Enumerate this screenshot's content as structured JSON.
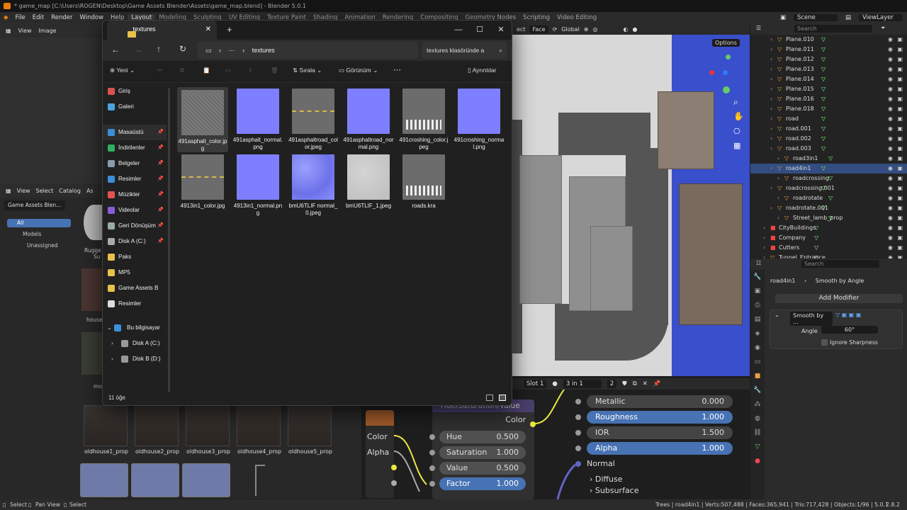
{
  "window": {
    "title": "* game_map [C:\\Users\\ROGEN\\Desktop\\Game Assets Blender\\Assets\\game_map.blend] - Blender 5.0.1"
  },
  "menu": [
    "File",
    "Edit",
    "Render",
    "Window",
    "Help"
  ],
  "workspace_tabs": [
    "Layout",
    "Modeling",
    "Sculpting",
    "UV Editing",
    "Texture Paint",
    "Shading",
    "Animation",
    "Rendering",
    "Compositing",
    "Geometry Nodes",
    "Scripting",
    "Video Editing"
  ],
  "scene": {
    "scene_label": "Scene",
    "viewlayer_label": "ViewLayer"
  },
  "image_editor": {
    "view": "View",
    "image": "Image"
  },
  "asset_browser": {
    "menus": [
      "View",
      "Select",
      "Catalog",
      "As"
    ],
    "library": "Game Assets Blen...",
    "all": "All",
    "models": "Models",
    "unassigned": "Unassigned",
    "props": [
      "oldhouse1_prop",
      "oldhouse2_prop",
      "oldhouse3_prop",
      "oldhouse4_prop",
      "oldhouse5_prop"
    ],
    "side_labels": [
      "Rugge",
      "Su",
      "house",
      "mo"
    ]
  },
  "viewport": {
    "mode": "Face",
    "orientation": "Global",
    "options": "Options",
    "select_label": "ect"
  },
  "outliner": {
    "search_placeholder": "Search",
    "rows": [
      {
        "name": "Plane.010",
        "indent": 2
      },
      {
        "name": "Plane.011",
        "indent": 2
      },
      {
        "name": "Plane.012",
        "indent": 2
      },
      {
        "name": "Plane.013",
        "indent": 2
      },
      {
        "name": "Plane.014",
        "indent": 2
      },
      {
        "name": "Plane.015",
        "indent": 2
      },
      {
        "name": "Plane.016",
        "indent": 2
      },
      {
        "name": "Plane.018",
        "indent": 2
      },
      {
        "name": "road",
        "indent": 2
      },
      {
        "name": "road.001",
        "indent": 2
      },
      {
        "name": "road.002",
        "indent": 2
      },
      {
        "name": "road.003",
        "indent": 2
      },
      {
        "name": "road3in1",
        "indent": 3
      },
      {
        "name": "road4in1",
        "indent": 2,
        "selected": true
      },
      {
        "name": "roadcrossing",
        "indent": 3
      },
      {
        "name": "roadcrossing.001",
        "indent": 2
      },
      {
        "name": "roadrotate",
        "indent": 3
      },
      {
        "name": "roadrotate.001",
        "indent": 2
      },
      {
        "name": "Street_lamb_prop",
        "indent": 3
      },
      {
        "name": "CityBuildings",
        "indent": 1,
        "collection": true
      },
      {
        "name": "Company",
        "indent": 1,
        "collection": true
      },
      {
        "name": "Cutters",
        "indent": 1,
        "collection": true
      },
      {
        "name": "Tunnel_Entrance",
        "indent": 1
      }
    ]
  },
  "properties": {
    "search_placeholder": "Search",
    "object": "road4in1",
    "modifier_breadcrumb": "Smooth by Angle",
    "add_modifier": "Add Modifier",
    "modifier_name": "Smooth by ...",
    "angle_label": "Angle",
    "angle_value": "60°",
    "ignore_sharpness": "Ignore Sharpness"
  },
  "node_editor": {
    "slot": "Slot 1",
    "material": "3 in 1",
    "users": "2",
    "hsv_title": "Hue/Saturation/Value",
    "hsv_out": "Color",
    "hsv_inputs": [
      {
        "label": "Hue",
        "value": "0.500"
      },
      {
        "label": "Saturation",
        "value": "1.000"
      },
      {
        "label": "Value",
        "value": "0.500"
      },
      {
        "label": "Factor",
        "value": "1.000"
      }
    ],
    "left_outputs": [
      "Color",
      "Alpha"
    ],
    "bsdf_inputs": [
      {
        "label": "Metallic",
        "value": "0.000"
      },
      {
        "label": "Roughness",
        "value": "1.000"
      },
      {
        "label": "IOR",
        "value": "1.500"
      },
      {
        "label": "Alpha",
        "value": "1.000"
      }
    ],
    "normal": "Normal",
    "diffuse": "Diffuse",
    "subsurface": "Subsurface"
  },
  "statusbar": {
    "select": "Select",
    "pan": "Pan View",
    "select2": "Select",
    "stats": "Trees | road4in1 | Verts:507,488 | Faces:365,941 | Tris:717,428 | Objects:1/96 | 5.0.1",
    "version": "2.8.2"
  },
  "explorer": {
    "tab_title": "textures",
    "address_more": "⋯",
    "address": "textures",
    "search": "textures klasöründe a",
    "toolbar": {
      "new": "Yeni",
      "sort": "Sırala",
      "view": "Görünüm",
      "details": "Ayrıntılar"
    },
    "nav": [
      {
        "label": "Giriş",
        "color": "#d9534f",
        "pin": false
      },
      {
        "label": "Galeri",
        "color": "#4aa3df",
        "pin": false
      },
      {
        "label": "Masaüstü",
        "color": "#3b8fd9",
        "pin": true,
        "selected": true
      },
      {
        "label": "İndirilenler",
        "color": "#2eae5f",
        "pin": true
      },
      {
        "label": "Belgeler",
        "color": "#8a9bb0",
        "pin": true
      },
      {
        "label": "Resimler",
        "color": "#3b8fd9",
        "pin": true
      },
      {
        "label": "Müzikler",
        "color": "#e2534f",
        "pin": true
      },
      {
        "label": "Videolar",
        "color": "#8a5cd9",
        "pin": true
      },
      {
        "label": "Geri Dönüşüm",
        "color": "#9aa",
        "pin": true
      },
      {
        "label": "Disk A (C:)",
        "color": "#aaa",
        "pin": true
      },
      {
        "label": "Paks",
        "color": "#e8c04a",
        "pin": false
      },
      {
        "label": "MP5",
        "color": "#e8c04a",
        "pin": false
      },
      {
        "label": "Game Assets B",
        "color": "#e8c04a",
        "pin": false
      },
      {
        "label": "Resimler",
        "color": "#ddd",
        "pin": false
      }
    ],
    "this_pc": "Bu bilgisayar",
    "disks": [
      "Disk A (C:)",
      "Disk B (D:)"
    ],
    "files": [
      {
        "name": "491asphalt_color.jpg",
        "kind": "asphalt"
      },
      {
        "name": "491asphalt_normal.png",
        "kind": "blue"
      },
      {
        "name": "491asphaltroad_color.jpeg",
        "kind": "road"
      },
      {
        "name": "491asphaltroad_normal.png",
        "kind": "blue"
      },
      {
        "name": "491croshing_color.jpeg",
        "kind": "cross"
      },
      {
        "name": "491croshing_normal.png",
        "kind": "blue"
      },
      {
        "name": "4913in1_color.jpg",
        "kind": "road"
      },
      {
        "name": "4913in1_normal.png",
        "kind": "blue"
      },
      {
        "name": "bmU6TLIF normal_0.jpeg",
        "kind": "normal2"
      },
      {
        "name": "bmU6TLIF_1.jpeg",
        "kind": "white"
      },
      {
        "name": "roads.kra",
        "kind": "cross"
      }
    ],
    "status": "11 öğe"
  }
}
